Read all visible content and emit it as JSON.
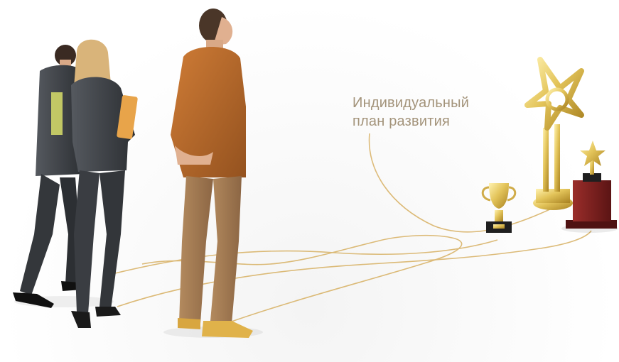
{
  "caption": {
    "line1": "Индивидуальный",
    "line2": "план развития"
  },
  "colors": {
    "caption_text": "#a3937a",
    "path_lines": "#d9b46a",
    "gold": "#e3c45a",
    "brown_jacket": "#b86a2c",
    "dark_suit": "#3c3f44",
    "trophy_base": "#7a1f1f"
  },
  "icons": [
    "trophy-cup-icon",
    "star-trophy-icon",
    "small-star-trophy-icon"
  ]
}
